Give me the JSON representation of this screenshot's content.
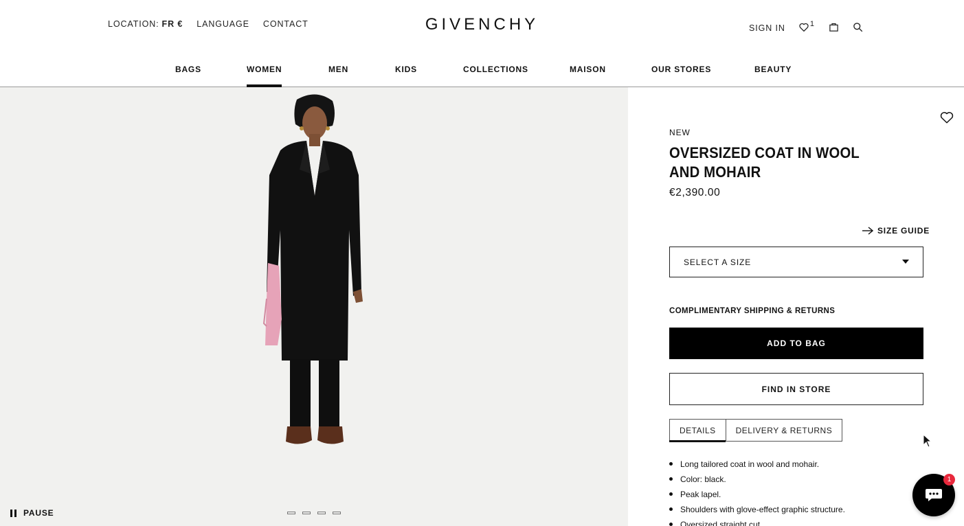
{
  "header": {
    "location_label": "LOCATION:",
    "location_value": "FR €",
    "language": "LANGUAGE",
    "contact": "CONTACT",
    "logo": "GIVENCHY",
    "sign_in": "SIGN IN",
    "wishlist_count": "1"
  },
  "nav": {
    "items": [
      "BAGS",
      "WOMEN",
      "MEN",
      "KIDS",
      "COLLECTIONS",
      "MAISON",
      "OUR STORES",
      "BEAUTY"
    ],
    "active": "WOMEN"
  },
  "gallery": {
    "pause_label": "PAUSE",
    "slides_total": 4
  },
  "product": {
    "badge": "NEW",
    "title": "OVERSIZED COAT IN WOOL AND MOHAIR",
    "price": "€2,390.00",
    "size_guide": "SIZE GUIDE",
    "size_placeholder": "SELECT A SIZE",
    "shipping": "COMPLIMENTARY SHIPPING & RETURNS",
    "add_to_bag": "ADD TO BAG",
    "find_in_store": "FIND IN STORE",
    "tabs": [
      "DETAILS",
      "DELIVERY & RETURNS"
    ],
    "active_tab": "DETAILS",
    "details": [
      "Long tailored coat in wool and mohair.",
      "Color: black.",
      "Peak lapel.",
      "Shoulders with glove-effect graphic structure.",
      "Oversized straight cut."
    ]
  },
  "chat": {
    "badge": "1"
  },
  "colors": {
    "primary": "#000000",
    "gallery_bg": "#f1f1ef",
    "chat_badge": "#e8283c",
    "accessory": "#e6a3b8"
  },
  "icons": [
    "heart-icon",
    "bag-icon",
    "search-icon",
    "arrow-right-icon",
    "caret-down-icon",
    "pause-icon",
    "chat-icon"
  ]
}
